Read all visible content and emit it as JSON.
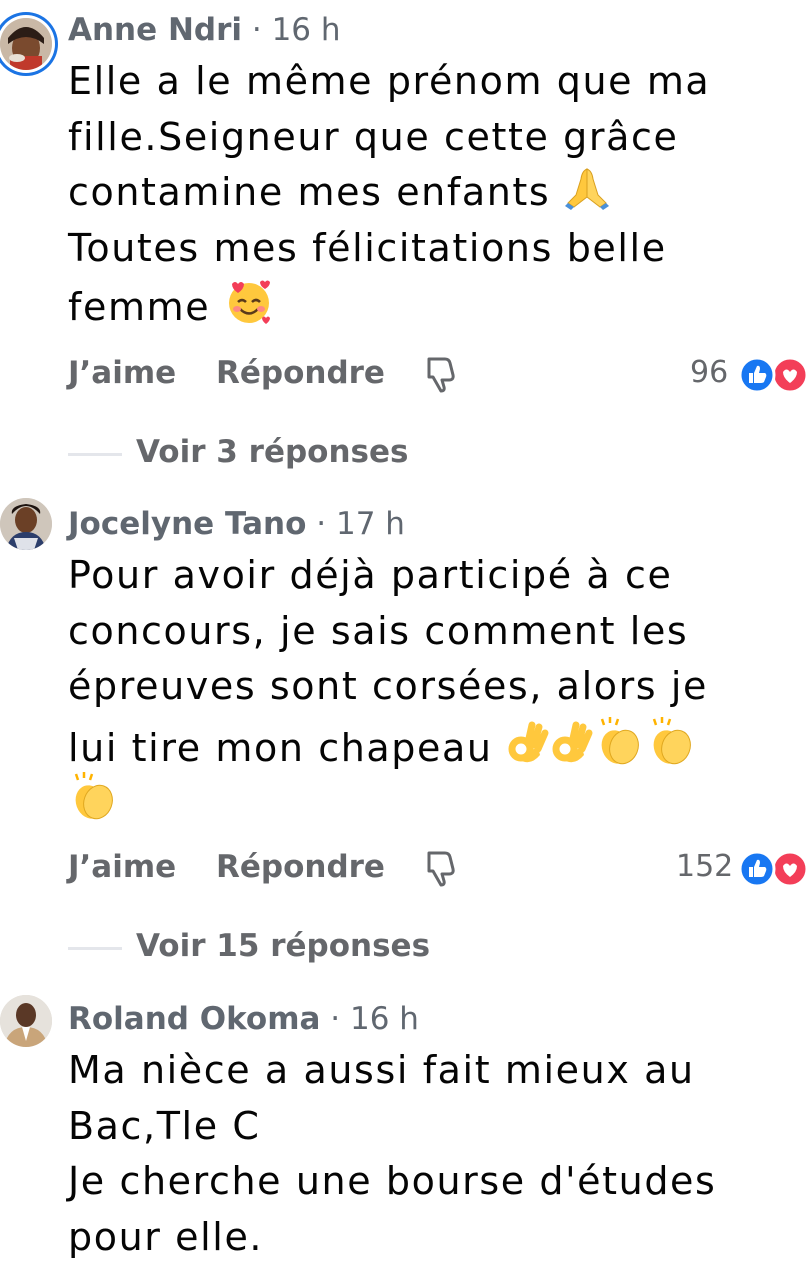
{
  "comments": [
    {
      "author": "Anne Ndri",
      "separator": "·",
      "time": "16 h",
      "lines": [
        "Elle a le même prénom  que ma",
        "fille.Seigneur que cette grâce",
        "contamine mes enfants",
        "Toutes mes félicitations belle",
        "femme"
      ],
      "emojis": [
        "praying-hands",
        "smiling-face-with-hearts"
      ],
      "like_label": "J’aime",
      "reply_label": "Répondre",
      "reaction_count": "96",
      "reactions": [
        "like",
        "love"
      ],
      "replies_label": "Voir 3 réponses"
    },
    {
      "author": "Jocelyne Tano",
      "separator": "·",
      "time": "17 h",
      "lines": [
        "Pour avoir déjà participé à ce",
        "concours,  je sais comment les",
        "épreuves sont corsées,  alors je",
        "lui tire mon chapeau"
      ],
      "emojis": [
        "ok-hand",
        "ok-hand",
        "clapping-hands",
        "clapping-hands",
        "clapping-hands"
      ],
      "like_label": "J’aime",
      "reply_label": "Répondre",
      "reaction_count": "152",
      "reactions": [
        "like",
        "love"
      ],
      "replies_label": "Voir 15 réponses"
    },
    {
      "author": "Roland Okoma",
      "separator": "·",
      "time": "16 h",
      "lines": [
        "Ma nièce a aussi fait mieux au",
        "Bac,Tle C",
        "Je cherche une bourse d'études",
        "pour elle."
      ]
    }
  ],
  "colors": {
    "secondary_text": "#65676b",
    "like_blue": "#1877f2",
    "love_red": "#f33e58",
    "emoji_yellow": "#ffc83d"
  }
}
